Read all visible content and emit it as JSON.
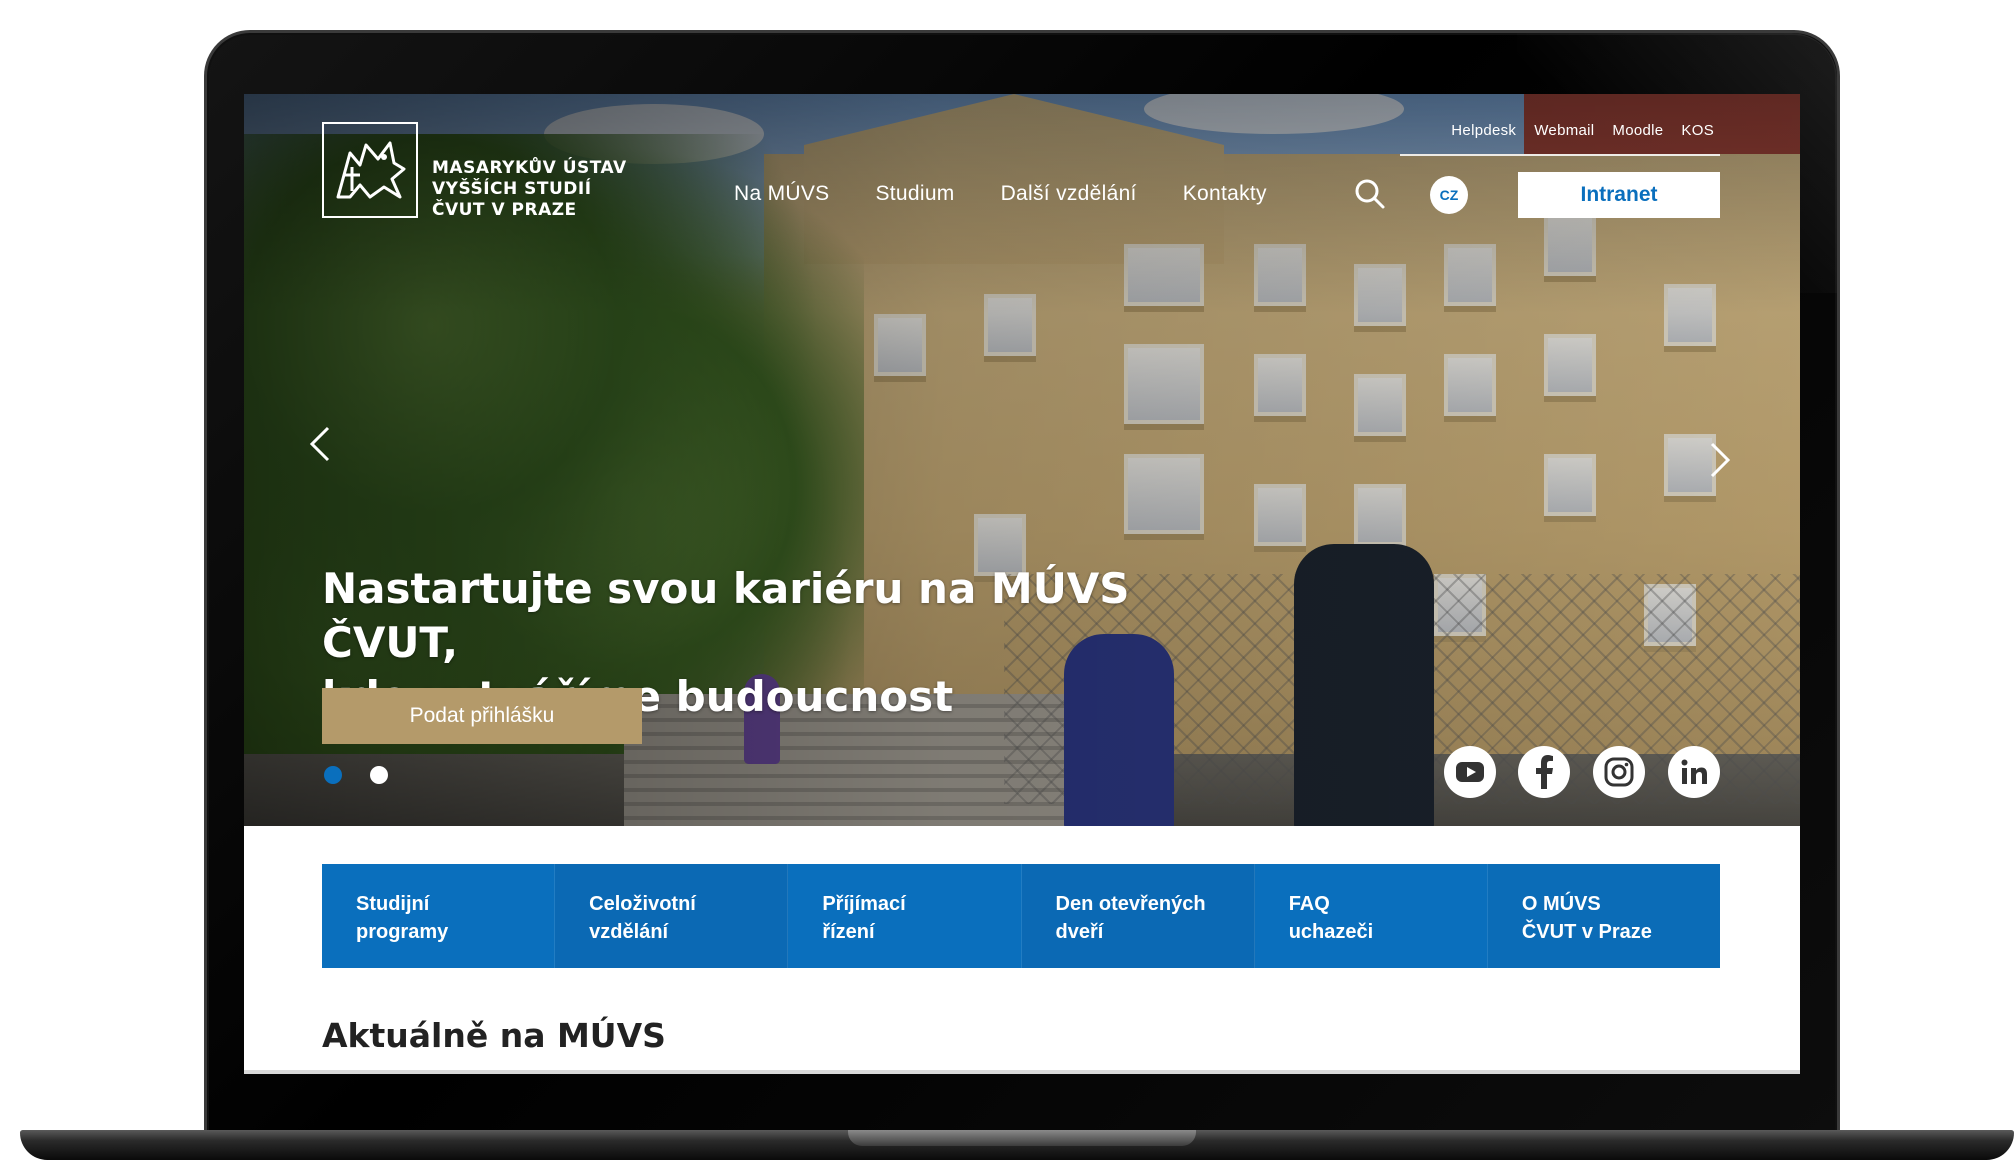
{
  "site": {
    "logo_lines": [
      "MASARYKŮV ÚSTAV",
      "VYŠŠÍCH STUDIÍ",
      "ČVUT V PRAZE"
    ]
  },
  "top_links": [
    "Helpdesk",
    "Webmail",
    "Moodle",
    "KOS"
  ],
  "nav": {
    "items": [
      "Na MÚVS",
      "Studium",
      "Další vzdělání",
      "Kontakty"
    ],
    "language": "CZ",
    "intranet_label": "Intranet"
  },
  "hero": {
    "title_line1": "Nastartujte svou kariéru na MÚVS ČVUT,",
    "title_line2": "kde vytváříme budoucnost",
    "cta_label": "Podat přihlášku",
    "slides_total": 2,
    "active_slide": 1
  },
  "social": [
    "youtube-icon",
    "facebook-icon",
    "instagram-icon",
    "linkedin-icon"
  ],
  "quick_links": [
    {
      "line1": "Studijní",
      "line2": "programy"
    },
    {
      "line1": "Celoživotní",
      "line2": "vzdělání"
    },
    {
      "line1": "Příjímací",
      "line2": "řízení"
    },
    {
      "line1": "Den otevřených",
      "line2": "dveří"
    },
    {
      "line1": "FAQ",
      "line2": "uchazeči"
    },
    {
      "line1": "O MÚVS",
      "line2": "ČVUT v Praze"
    }
  ],
  "news": {
    "title": "Aktuálně na MÚVS"
  },
  "colors": {
    "brand_blue": "#0a6fbd",
    "cta_gold": "#b49a6a",
    "dot_active": "#0a6fbd",
    "dot_inactive": "#ffffff"
  }
}
